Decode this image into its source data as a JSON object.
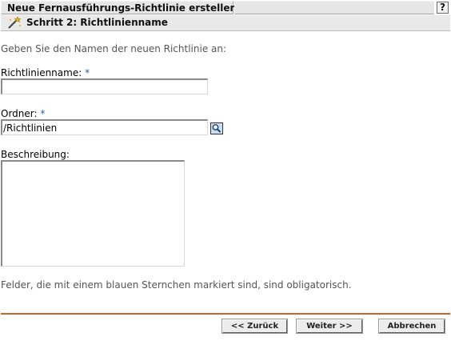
{
  "header": {
    "title": "Neue Fernausführungs-Richtlinie erstellen",
    "help_label": "?",
    "step_title": "Schritt 2: Richtlinienname",
    "step_icon": "wizard-wand-icon"
  },
  "form": {
    "intro": "Geben Sie den Namen der neuen Richtlinie an:",
    "required_marker": "*",
    "name": {
      "label": "Richtlinienname:",
      "value": ""
    },
    "folder": {
      "label": "Ordner:",
      "value": "/Richtlinien",
      "browse_icon": "magnifier-browse-icon"
    },
    "description": {
      "label": "Beschreibung:",
      "value": ""
    },
    "footnote": "Felder, die mit einem blauen Sternchen markiert sind, sind obligatorisch."
  },
  "buttons": {
    "back": "<< Zurück",
    "next": "Weiter >>",
    "cancel": "Abbrechen"
  },
  "colors": {
    "required_asterisk": "#1f5fb5",
    "divider": "#c6682d",
    "header_bg": "#e6e6e6"
  }
}
